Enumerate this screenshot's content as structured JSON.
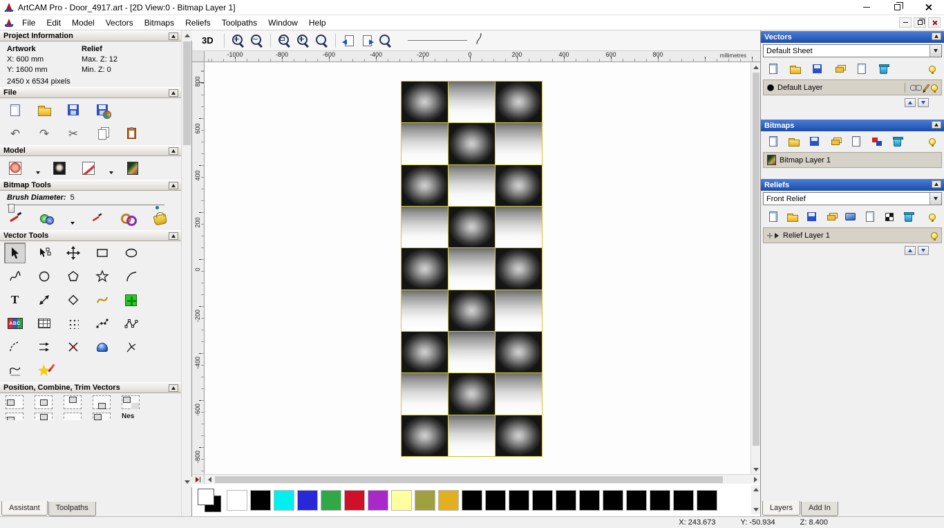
{
  "titlebar": {
    "title": "ArtCAM Pro - Door_4917.art - [2D View:0 - Bitmap Layer 1]"
  },
  "menubar": {
    "items": [
      "File",
      "Edit",
      "Model",
      "Vectors",
      "Bitmaps",
      "Reliefs",
      "Toolpaths",
      "Window",
      "Help"
    ]
  },
  "glyphs": {
    "view_3d": "3D",
    "undo": "↶",
    "redo": "↷",
    "cut": "✂",
    "text_tool": "T",
    "abc": "ABC",
    "nesting": "Nes"
  },
  "left_panel": {
    "project_information": {
      "header": "Project Information",
      "artwork_label": "Artwork",
      "relief_label": "Relief",
      "artwork_x": "X: 600 mm",
      "artwork_y": "Y: 1600 mm",
      "relief_max": "Max. Z: 12",
      "relief_min": "Min. Z: 0",
      "pixels": "2450 x 6534 pixels"
    },
    "file_header": "File",
    "model_header": "Model",
    "bitmap_tools_header": "Bitmap Tools",
    "brush_diameter_label": "Brush Diameter:",
    "brush_diameter_value": "5",
    "vector_tools_header": "Vector Tools",
    "position_header": "Position, Combine, Trim Vectors",
    "tabs": [
      "Assistant",
      "Toolpaths"
    ],
    "active_tab": "Assistant"
  },
  "canvas": {
    "ruler_h_ticks": [
      "-1000",
      "-800",
      "-600",
      "-400",
      "-200",
      "0",
      "200",
      "400",
      "600",
      "800"
    ],
    "ruler_unit": "millimetres",
    "ruler_v_ticks": [
      "800",
      "600",
      "400",
      "200",
      "0",
      "-200",
      "-400",
      "-600",
      "-800"
    ],
    "door_pattern": [
      "DLD",
      "LDL",
      "DLD",
      "LDL",
      "DLD",
      "LDL",
      "DLD",
      "LDL",
      "DLD"
    ],
    "door_outline_color": "#d8d23c",
    "palette_colors": [
      "#ffffff",
      "#000000",
      "#00f0f0",
      "#2828d8",
      "#30a848",
      "#d01028",
      "#a828c8",
      "#ffffa0",
      "#a0a040",
      "#e0b020",
      "#000000",
      "#000000",
      "#000000",
      "#000000",
      "#000000",
      "#000000",
      "#000000",
      "#000000",
      "#000000",
      "#000000",
      "#000000"
    ]
  },
  "right_panel": {
    "vectors": {
      "header": "Vectors",
      "sheet_select": "Default Sheet",
      "layer_name": "Default Layer"
    },
    "bitmaps": {
      "header": "Bitmaps",
      "layer_name": "Bitmap Layer 1"
    },
    "reliefs": {
      "header": "Reliefs",
      "relief_select": "Front Relief",
      "layer_name": "Relief Layer 1"
    },
    "tabs": [
      "Layers",
      "Add In"
    ],
    "active_tab": "Layers"
  },
  "statusbar": {
    "x": "X: 243.673",
    "y": "Y: -50.934",
    "z": "Z: 8.400"
  }
}
